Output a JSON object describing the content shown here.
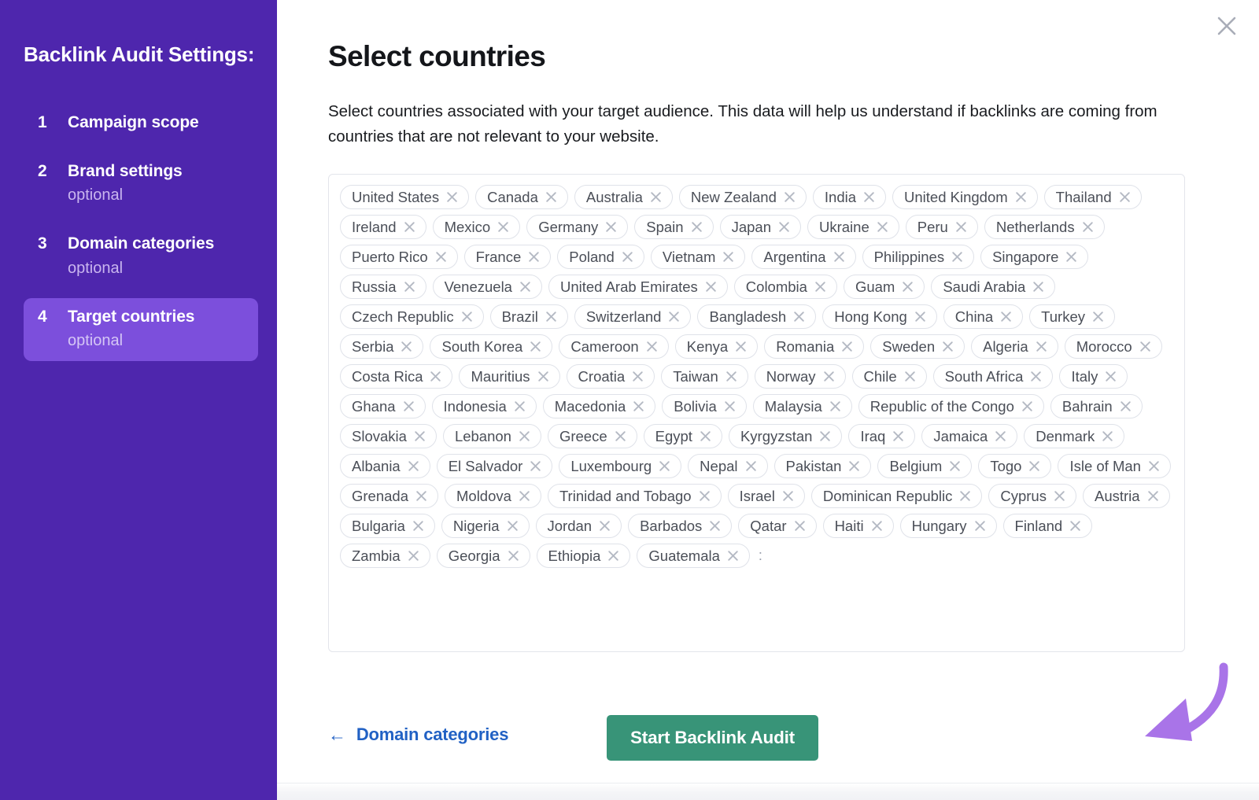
{
  "sidebar": {
    "title": "Backlink Audit Settings:",
    "items": [
      {
        "num": "1",
        "label": "Campaign scope",
        "sub": ""
      },
      {
        "num": "2",
        "label": "Brand settings",
        "sub": "optional"
      },
      {
        "num": "3",
        "label": "Domain categories",
        "sub": "optional"
      },
      {
        "num": "4",
        "label": "Target countries",
        "sub": "optional"
      }
    ]
  },
  "main": {
    "close_icon": "close-icon",
    "title": "Select countries",
    "description": "Select countries associated with your target audience. This data will help us understand if backlinks are coming from countries that are not relevant to your website.",
    "input_caret": ":",
    "countries": [
      "United States",
      "Canada",
      "Australia",
      "New Zealand",
      "India",
      "United Kingdom",
      "Thailand",
      "Ireland",
      "Mexico",
      "Germany",
      "Spain",
      "Japan",
      "Ukraine",
      "Peru",
      "Netherlands",
      "Puerto Rico",
      "France",
      "Poland",
      "Vietnam",
      "Argentina",
      "Philippines",
      "Singapore",
      "Russia",
      "Venezuela",
      "United Arab Emirates",
      "Colombia",
      "Guam",
      "Saudi Arabia",
      "Czech Republic",
      "Brazil",
      "Switzerland",
      "Bangladesh",
      "Hong Kong",
      "China",
      "Turkey",
      "Serbia",
      "South Korea",
      "Cameroon",
      "Kenya",
      "Romania",
      "Sweden",
      "Algeria",
      "Morocco",
      "Costa Rica",
      "Mauritius",
      "Croatia",
      "Taiwan",
      "Norway",
      "Chile",
      "South Africa",
      "Italy",
      "Ghana",
      "Indonesia",
      "Macedonia",
      "Bolivia",
      "Malaysia",
      "Republic of the Congo",
      "Bahrain",
      "Slovakia",
      "Lebanon",
      "Greece",
      "Egypt",
      "Kyrgyzstan",
      "Iraq",
      "Jamaica",
      "Denmark",
      "Albania",
      "El Salvador",
      "Luxembourg",
      "Nepal",
      "Pakistan",
      "Belgium",
      "Togo",
      "Isle of Man",
      "Grenada",
      "Moldova",
      "Trinidad and Tobago",
      "Israel",
      "Dominican Republic",
      "Cyprus",
      "Austria",
      "Bulgaria",
      "Nigeria",
      "Jordan",
      "Barbados",
      "Qatar",
      "Haiti",
      "Hungary",
      "Finland",
      "Zambia",
      "Georgia",
      "Ethiopia",
      "Guatemala"
    ],
    "chip_remove_icon": "close-icon"
  },
  "footer": {
    "back_icon": "arrow-left-icon",
    "back_label": "Domain categories",
    "start_label": "Start Backlink Audit"
  },
  "annotation": {
    "icon": "curved-arrow-icon",
    "color": "#a974e8"
  },
  "colors": {
    "sidebar_bg": "#4e26ad",
    "sidebar_active": "#7c4fdc",
    "primary_button": "#389478",
    "link": "#2161c4",
    "chip_border": "#dfe2e9",
    "annotation": "#a974e8"
  }
}
